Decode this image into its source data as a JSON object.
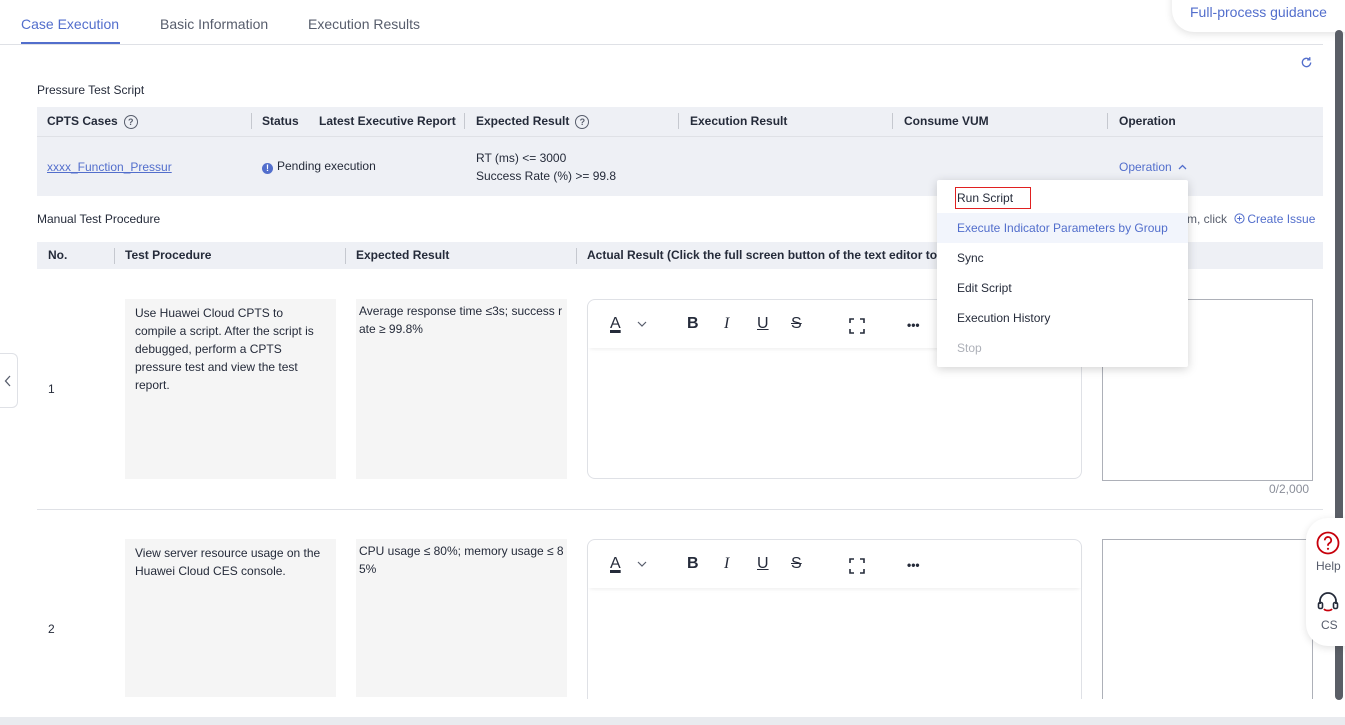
{
  "tabs": [
    {
      "label": "Case Execution"
    },
    {
      "label": "Basic Information"
    },
    {
      "label": "Execution Results"
    }
  ],
  "guidance": "Full-process guidance",
  "pressure": {
    "title": "Pressure Test Script",
    "headers": {
      "cases": "CPTS Cases",
      "status": "Status",
      "report": "Latest Executive Report",
      "expected": "Expected Result",
      "result": "Execution Result",
      "vum": "Consume VUM",
      "operation": "Operation"
    },
    "row": {
      "case": "xxxx_Function_Pressur",
      "status": "Pending execution",
      "expected1": "RT (ms) <= 3000",
      "expected2": "Success Rate (%) >= 99.8",
      "operation": "Operation"
    }
  },
  "manual": {
    "title": "Manual Test Procedure",
    "create_prefix": "m, click",
    "create_issue": "Create Issue",
    "headers": {
      "no": "No.",
      "procedure": "Test Procedure",
      "expected": "Expected Result",
      "actual": "Actual Result (Click the full screen button of the text editor to"
    },
    "rows": [
      {
        "no": "1",
        "procedure": "Use Huawei Cloud CPTS to compile a script. After the script is debugged, perform a CPTS pressure test and view the test report.",
        "expected": "Average response time ≤3s; success rate ≥ 99.8%",
        "counter": "0/2,000"
      },
      {
        "no": "2",
        "procedure": "View server resource usage on the Huawei Cloud CES console.",
        "expected": "CPU usage ≤ 80%; memory usage ≤ 85%"
      }
    ]
  },
  "dropdown": [
    {
      "label": "Run Script"
    },
    {
      "label": "Execute Indicator Parameters by Group"
    },
    {
      "label": "Sync"
    },
    {
      "label": "Edit Script"
    },
    {
      "label": "Execution History"
    },
    {
      "label": "Stop"
    }
  ],
  "toolbar": {
    "font_color": "A",
    "bold": "B",
    "italic": "I",
    "underline": "U",
    "strike": "S",
    "more": "•••"
  },
  "side": {
    "help": "Help",
    "cs": "CS"
  },
  "colors": {
    "accent": "#526ecc",
    "highlight_border": "#e02020"
  }
}
